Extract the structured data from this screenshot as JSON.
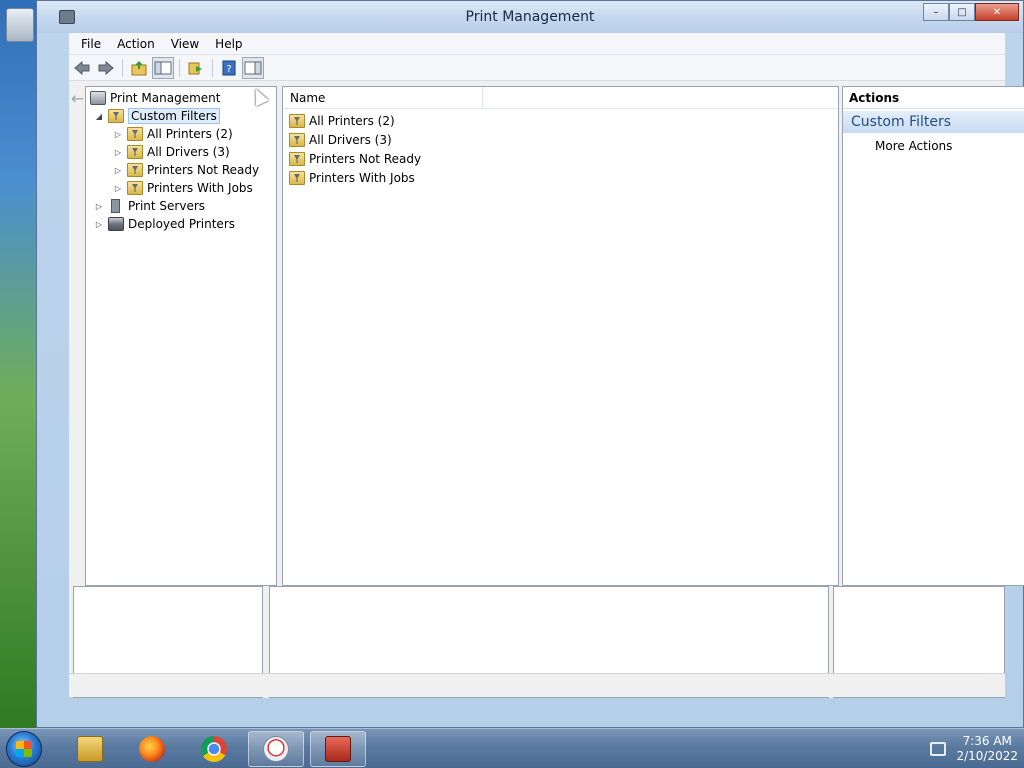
{
  "window": {
    "title": "Print Management",
    "controls": {
      "minimize": "–",
      "maximize": "□",
      "close": "✕"
    }
  },
  "menubar": {
    "items": [
      "File",
      "Action",
      "View",
      "Help"
    ]
  },
  "toolbar": {
    "buttons": [
      "back-icon",
      "forward-icon",
      "up-folder-icon",
      "show-hide-tree-icon",
      "export-list-icon",
      "help-icon",
      "show-hide-action-pane-icon"
    ]
  },
  "tree": {
    "root": "Print Management",
    "items": [
      {
        "label": "Custom Filters",
        "expander": "◢",
        "icon": "filter-folder-icon"
      },
      {
        "label": "All Printers (2)",
        "expander": "▷",
        "icon": "filter-folder-icon"
      },
      {
        "label": "All Drivers (3)",
        "expander": "▷",
        "icon": "filter-folder-icon"
      },
      {
        "label": "Printers Not Ready",
        "expander": "▷",
        "icon": "filter-folder-icon"
      },
      {
        "label": "Printers With Jobs",
        "expander": "▷",
        "icon": "filter-folder-icon"
      },
      {
        "label": "Print Servers",
        "expander": "▷",
        "icon": "server-icon"
      },
      {
        "label": "Deployed Printers",
        "expander": "▷",
        "icon": "printer-icon"
      }
    ]
  },
  "list": {
    "column_name": "Name",
    "rows": [
      "All Printers (2)",
      "All Drivers (3)",
      "Printers Not Ready",
      "Printers With Jobs"
    ]
  },
  "actions": {
    "title": "Actions",
    "group": "Custom Filters",
    "collapse": "▲",
    "items": [
      {
        "label": "More Actions",
        "arrow": "▶"
      }
    ]
  },
  "taskbar": {
    "apps": [
      "file-explorer-icon",
      "firefox-icon",
      "chrome-icon",
      "snipping-tool-icon",
      "print-management-icon"
    ],
    "time": "7:36 AM",
    "date": "2/10/2022"
  },
  "colors": {
    "selection": "#dfecfa",
    "actions_group_text": "#1f4d88",
    "taskbar": "#5a7aa0"
  }
}
